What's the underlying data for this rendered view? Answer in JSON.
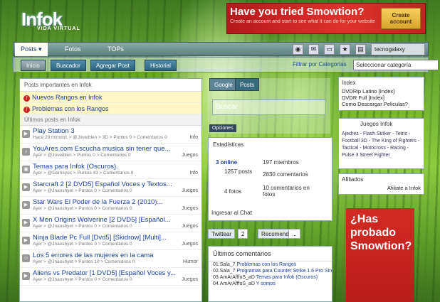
{
  "logo": {
    "text": "Infok",
    "sub": "VIDA VIRTUAL"
  },
  "banner": {
    "title": "Have you tried Smowtion?",
    "subtitle": "Create an account and start to see what it can do for your website",
    "button": "Create account"
  },
  "topbar": {
    "tabs": [
      "Posts",
      "Fotos",
      "TOPs"
    ],
    "user": "tecnogalaxy"
  },
  "nav": {
    "buttons": [
      "Inicio",
      "Buscador",
      "Agregar Post",
      "Historial"
    ],
    "filter_link": "Filtrar por Categorías",
    "select_value": "Seleccionar categoría"
  },
  "important": {
    "header": "Posts importantes en Infok",
    "items": [
      "Nuevos Rangos en Infok",
      "Problemas con los Rangos"
    ]
  },
  "recent_header": "Últimos posts en Infok",
  "posts": [
    {
      "title": "Play Station 3",
      "meta": "Hace 29 minutos > @Joveiblen > 3D > Puntos 0 > Comentarios 0",
      "cat": "Info"
    },
    {
      "title": "YouAres.com Escucha musica sin tener que...",
      "meta": "Ayer > @Joveiblen > Puntos 0 > Comentarios 0",
      "cat": "Juegos"
    },
    {
      "title": "Temas para Infok (Oscuros).",
      "meta": "Ayer > @Gameyex > Puntos 43 > Comentarios 0",
      "cat": "Info"
    },
    {
      "title": "Starcraft 2 [2 DVD5] Español Voces y Textos...",
      "meta": "Ayer > @Jnaoshyet > Puntos 0 > Comentarios 0",
      "cat": "Juegos"
    },
    {
      "title": "Star Wars El Poder de la Fuerza 2 (2010)...",
      "meta": "Ayer > @Jnaoshyet > Puntos 0 > Comentarios 0",
      "cat": "Juegos"
    },
    {
      "title": "X Men Origins Wolverine [2 DVD5] [Español...",
      "meta": "Ayer > @Jnaoshyet > Puntos 0 > Comentarios 0",
      "cat": "Juegos"
    },
    {
      "title": "Ninja Blade Pc Full [Dvd5] [Skidrow] [Multi]...",
      "meta": "Ayer > @Jnaoshyet > Puntos 0 > Comentarios 0",
      "cat": "Juegos"
    },
    {
      "title": "Los 5 errores de las mujeres en la cama",
      "meta": "Ayer > @Jnaoshyet > Puntos 10 > Comentarios 0",
      "cat": "Humor"
    },
    {
      "title": "Aliens vs Predator [1 DVD5] [Español Voces y...",
      "meta": "Ayer > @Jnaoshyet > Puntos 0 > Comentarios 0",
      "cat": "Juegos"
    }
  ],
  "search": {
    "tabs": [
      "Google",
      "Posts"
    ],
    "placeholder": "Buscar",
    "options": "Opciones"
  },
  "stats": {
    "header": "Estadísticas",
    "online": "3 online",
    "members": "197 miembros",
    "posts": "1257 posts",
    "comments": "2830 comentarios",
    "photos": "4 fotos",
    "photo_comments": "10 comentarios en fotos",
    "chat": "Ingresar al Chat"
  },
  "social": {
    "twitter": "Twittear",
    "twitter_count": "2",
    "fb": "Recomendar",
    "fb_count": "..."
  },
  "comments": {
    "header": "Últimos comentarios",
    "items": [
      {
        "user": "01.Sala_7",
        "text": "Problemas con los Rangos"
      },
      {
        "user": "02.Sala_7",
        "text": "Programas para Counter Strike 1.6 Pro Stream"
      },
      {
        "user": "03.AmArAfffuS_aD",
        "text": "Temas para Infok (Oscuros)"
      },
      {
        "user": "04.AmArAfffuS_aD",
        "text": "Y somos"
      }
    ]
  },
  "index": {
    "title": "Index",
    "links": [
      "DVDRip Latino [Index]",
      "DVDR Full [Index]",
      "Como Descargar Peliculas?"
    ]
  },
  "games": {
    "title": "Juegos Infok",
    "text": "Ajedrez - Flash Striker - Tetris - Football 3D - The King of Fighters - Tactical - Motocross - Racing - Pulse 3 Street Fighter"
  },
  "affiliates": {
    "title": "Afiliados",
    "link": "Afiliate a Infok"
  },
  "ad2": {
    "text": "¿Has probado Smowtion?"
  },
  "colors": {
    "accent": "#1b3fa5",
    "banner": "#d42a24",
    "nav": "#2d6480"
  }
}
